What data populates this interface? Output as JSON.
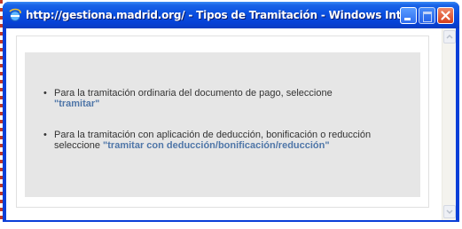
{
  "window": {
    "title": "http://gestiona.madrid.org/ - Tipos de Tramitación - Windows Internet Ex...",
    "icon": "internet-explorer-icon"
  },
  "content": {
    "item1": {
      "text_before": "Para la tramitación ordinaria del documento de pago, seleccione ",
      "link": "\"tramitar\""
    },
    "item2": {
      "text_before": "Para la tramitación con aplicación de deducción, bonificación o reducción seleccione ",
      "link": "\"tramitar con deducción/bonificación/reducción\""
    }
  },
  "colors": {
    "titlebar": "#0a4fe0",
    "link": "#4f76a8",
    "panel": "#e6e6e6"
  }
}
